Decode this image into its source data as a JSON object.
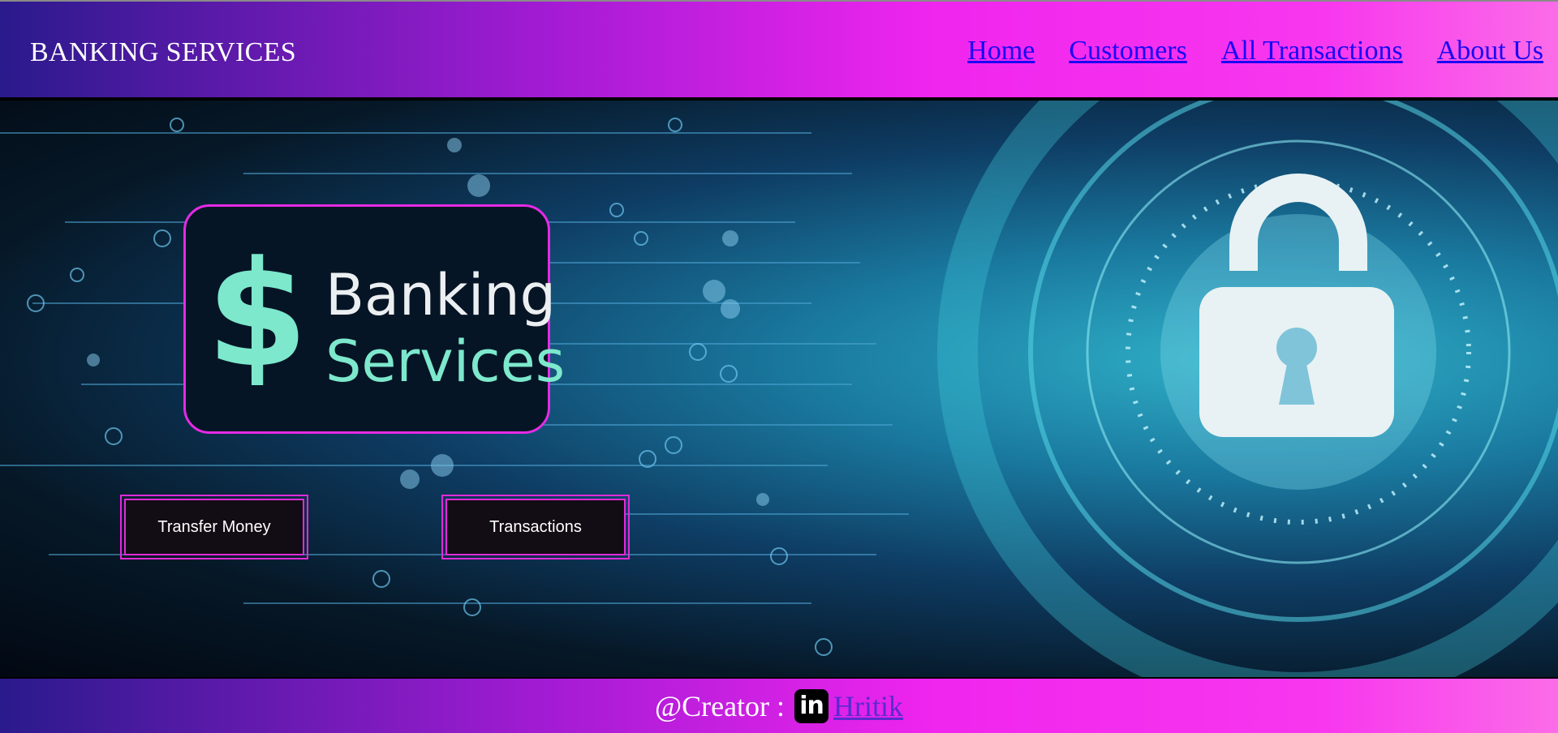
{
  "header": {
    "brand": "BANKING SERVICES",
    "nav": [
      {
        "label": "Home"
      },
      {
        "label": "Customers"
      },
      {
        "label": "All Transactions"
      },
      {
        "label": "About Us"
      }
    ]
  },
  "hero": {
    "logo": {
      "symbol": "$",
      "line1": "Banking",
      "line2": "Services"
    },
    "buttons": {
      "transfer": "Transfer Money",
      "transactions": "Transactions"
    }
  },
  "footer": {
    "creator_label": "@Creator :",
    "icon_text": "in",
    "creator_name": "Hritik"
  },
  "colors": {
    "accent_pink": "#f025ee",
    "accent_purple": "#2a1a8c",
    "nav_link": "#1a08f4",
    "logo_teal": "#7de8cc"
  },
  "icons": [
    "dollar-icon",
    "lock-icon",
    "linkedin-icon"
  ]
}
